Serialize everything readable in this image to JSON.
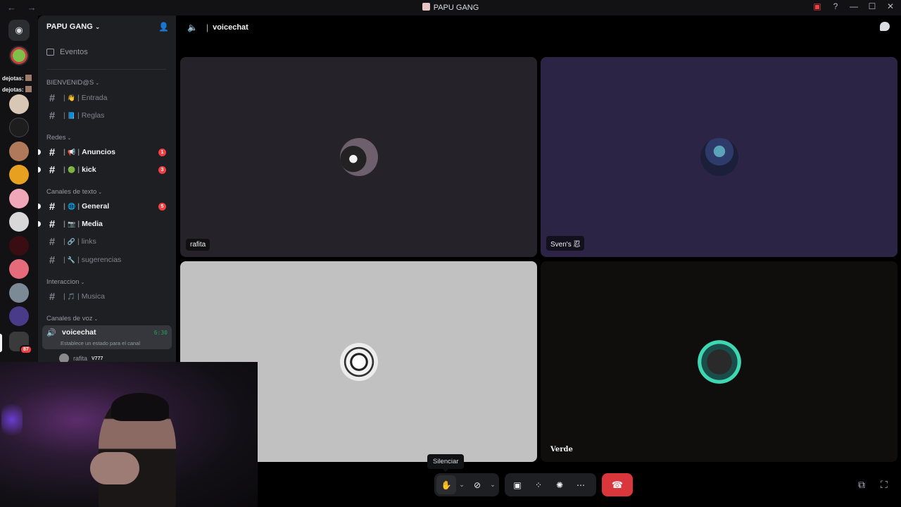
{
  "window": {
    "title": "PAPU GANG",
    "nav": "← →"
  },
  "guild_bar": {
    "dejotas_1": "dejotas:",
    "dejotas_2": "dejotas:",
    "mention_badge": "87"
  },
  "sidebar": {
    "server_name": "PAPU GANG",
    "events_label": "Eventos",
    "categories": {
      "bienvenidos": "BIENVENID@S",
      "redes": "Redes",
      "texto": "Canales de texto",
      "interaccion": "Interaccion",
      "voz": "Canales de voz"
    },
    "channels": {
      "entrada": {
        "emoji": "👋",
        "label": "Entrada"
      },
      "reglas": {
        "emoji": "📘",
        "label": "Reglas"
      },
      "anuncios": {
        "emoji": "📢",
        "label": "Anuncios",
        "count": "1"
      },
      "kick": {
        "emoji": "🟢",
        "label": "kick",
        "count": "3"
      },
      "general": {
        "emoji": "🌐",
        "label": "General",
        "count": "5"
      },
      "media": {
        "emoji": "📷",
        "label": "Media"
      },
      "links": {
        "emoji": "🔗",
        "label": "links"
      },
      "sugerencias": {
        "emoji": "🔧",
        "label": "sugerencias"
      },
      "musica": {
        "emoji": "🎵",
        "label": "Musica"
      }
    },
    "voice": {
      "label": "voicechat",
      "timer": "6:30",
      "status": "Establece un estado para el canal",
      "user": "rafita",
      "user_tag": "V777"
    }
  },
  "call": {
    "channel": "voicechat",
    "tiles": {
      "t1": "rafita",
      "t2": "Sven's 忍",
      "t4": "Verde"
    },
    "tooltip": "Silenciar"
  },
  "colors": {
    "accent_green": "#23a55a",
    "danger": "#da373c",
    "badge": "#f23f43"
  }
}
